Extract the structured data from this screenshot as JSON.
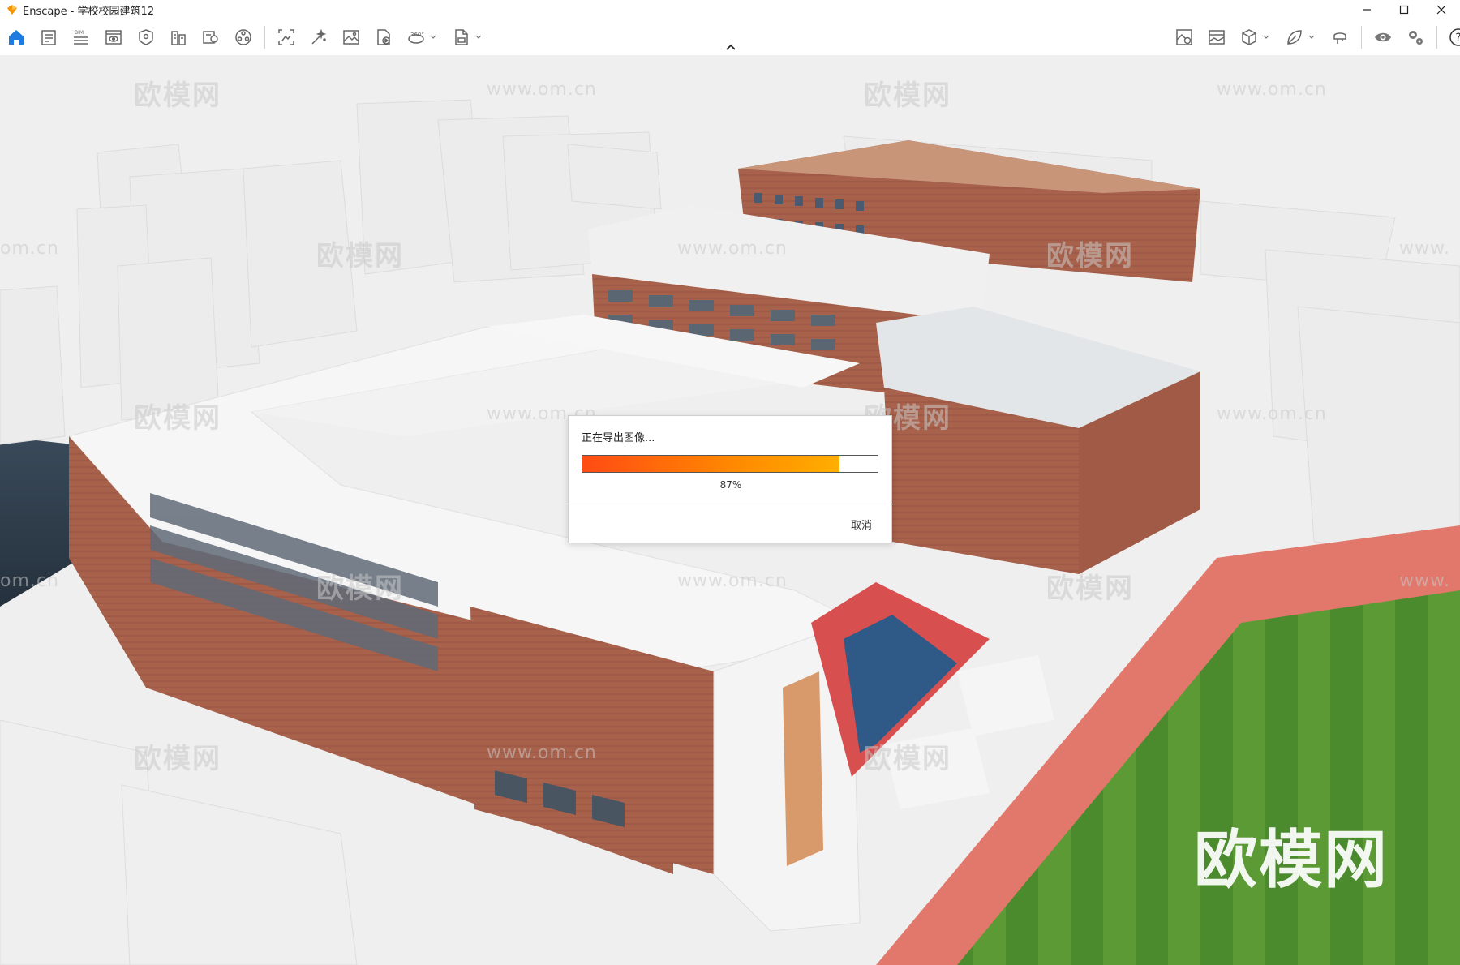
{
  "window": {
    "app_name": "Enscape",
    "title": "Enscape - 学校校园建筑12",
    "controls": [
      "minimize-icon",
      "maximize-icon",
      "close-icon"
    ]
  },
  "toolbar": {
    "left_icons": [
      "home-icon",
      "project-info-icon",
      "bim-icon",
      "views-icon",
      "asset-library-icon",
      "materials-icon",
      "material-editor-icon",
      "visual-settings-icon",
      "screenshot-icon",
      "batch-render-icon",
      "image-export-icon",
      "video-export-icon",
      "panorama-icon",
      "export-standalone-icon"
    ],
    "bim_label": "BIM",
    "panorama_label": "360°",
    "right_icons": [
      "capture-icon",
      "atmosphere-icon",
      "cube-icon",
      "leaf-icon",
      "vr-headset-icon",
      "eye-icon",
      "settings-icon",
      "help-icon"
    ],
    "help_label": "?"
  },
  "watermark": {
    "logo_text": "欧模网",
    "url_text": "www.om.cn",
    "url_partial": "om.cn",
    "url_partial_right": "www."
  },
  "dialog": {
    "title": "正在导出图像...",
    "progress": 0.87,
    "progress_text": "87%",
    "cancel_label": "取消"
  },
  "colors": {
    "accent": "#1e7be0",
    "progress_start": "#ff4b14",
    "progress_end": "#ffae00"
  }
}
